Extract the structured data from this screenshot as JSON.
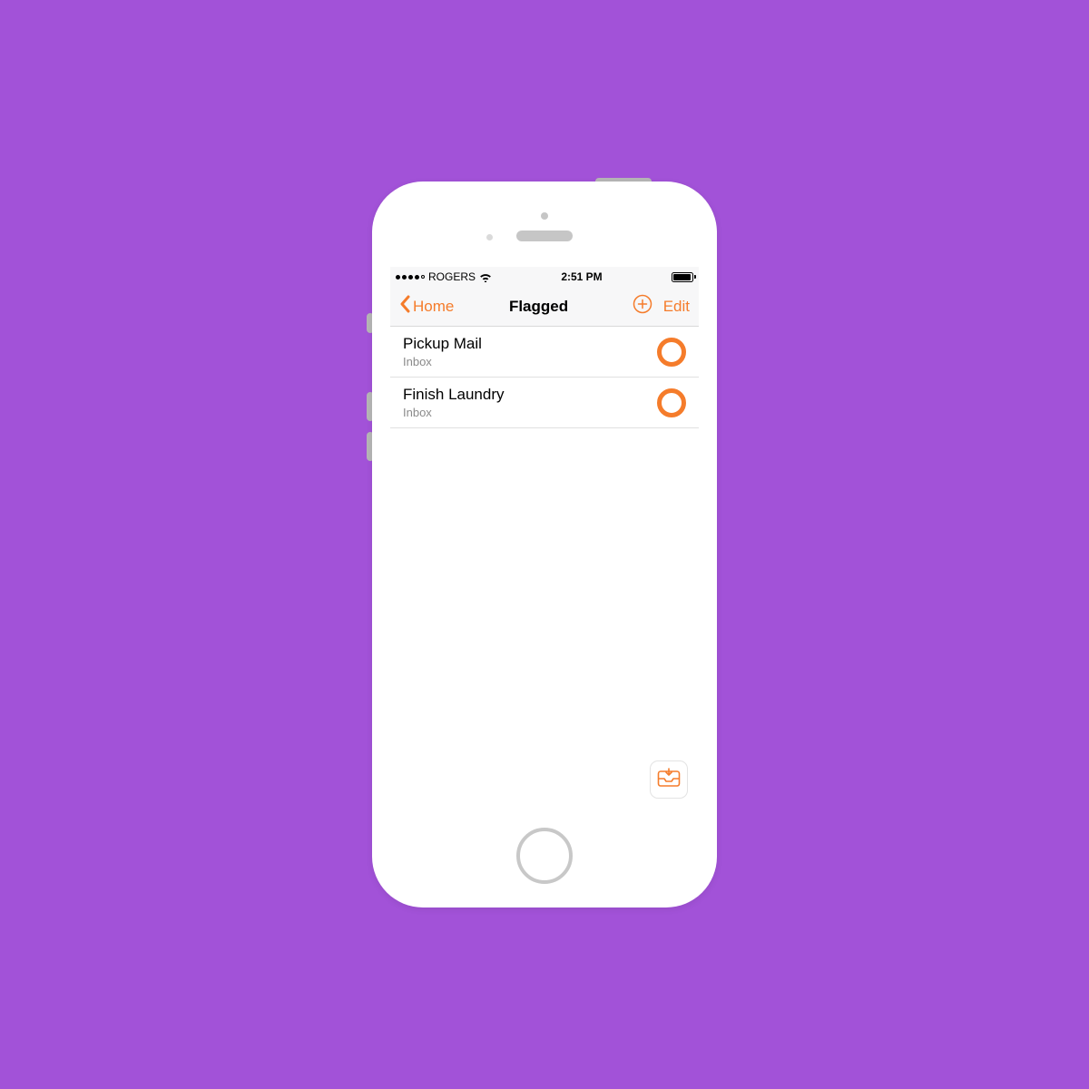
{
  "colors": {
    "accent": "#f57c2b",
    "bg": "#a252d8"
  },
  "status_bar": {
    "carrier": "ROGERS",
    "time": "2:51 PM"
  },
  "nav": {
    "back_label": "Home",
    "title": "Flagged",
    "edit_label": "Edit"
  },
  "items": [
    {
      "title": "Pickup Mail",
      "subtitle": "Inbox"
    },
    {
      "title": "Finish Laundry",
      "subtitle": "Inbox"
    }
  ]
}
